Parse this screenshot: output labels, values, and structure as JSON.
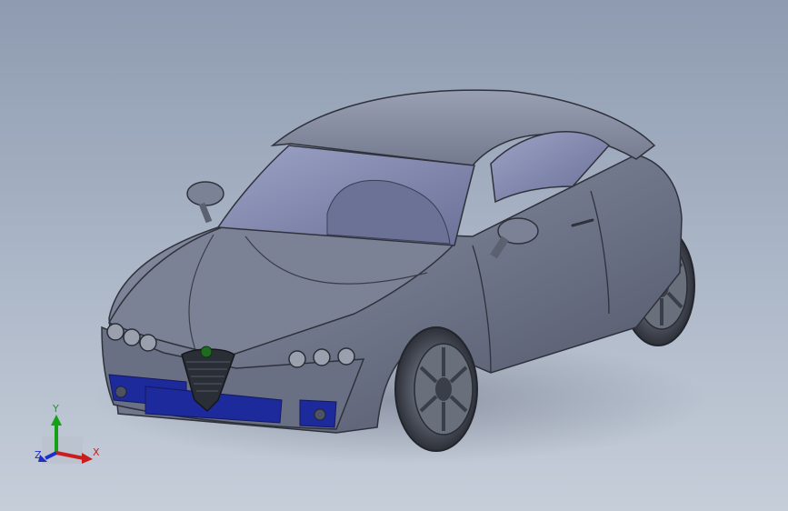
{
  "viewport": {
    "model_name": "",
    "background_colors": [
      "#8e9bb0",
      "#aab5c6",
      "#c6ced9"
    ]
  },
  "car": {
    "body_color": "#6f7689",
    "glass_color": "#7c82a6",
    "grille_color": "#2a2e36",
    "intake_color": "#1c2a9b",
    "badge_color": "#1f6b1f"
  },
  "triad": {
    "x_label": "X",
    "y_label": "Y",
    "z_label": "Z",
    "x_color": "#c81e1e",
    "y_color": "#16a016",
    "z_color": "#1e2fc8"
  }
}
